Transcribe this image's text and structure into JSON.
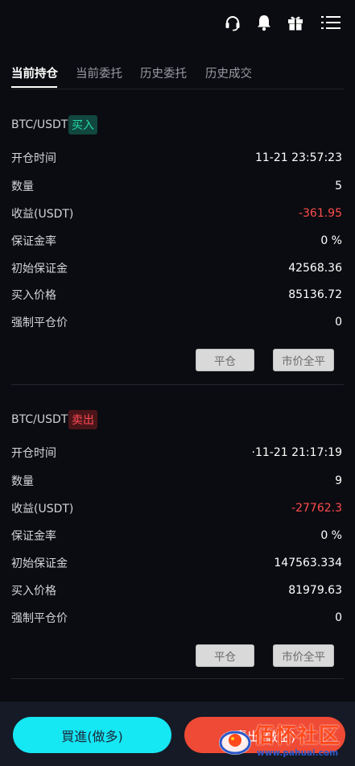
{
  "tabs": [
    "当前持仓",
    "当前委托",
    "历史委托",
    "历史成交"
  ],
  "icons": [
    "headset-icon",
    "bell-icon",
    "gift-icon",
    "menu-icon"
  ],
  "positions": [
    {
      "pair": "BTC/USDT",
      "side": "买入",
      "rows": [
        {
          "label": "开仓时间",
          "value": "11-21 23:57:23"
        },
        {
          "label": "数量",
          "value": "5"
        },
        {
          "label": "收益(USDT)",
          "value": "-361.95"
        },
        {
          "label": "保证金率",
          "value": "0 %"
        },
        {
          "label": "初始保证金",
          "value": "42568.36"
        },
        {
          "label": "买入价格",
          "value": "85136.72"
        },
        {
          "label": "强制平仓价",
          "value": "0"
        }
      ],
      "close_label": "平仓",
      "market_close_label": "市价全平"
    },
    {
      "pair": "BTC/USDT",
      "side": "卖出",
      "rows": [
        {
          "label": "开仓时间",
          "value": "·11-21 21:17:19"
        },
        {
          "label": "数量",
          "value": "9"
        },
        {
          "label": "收益(USDT)",
          "value": "-27762.3"
        },
        {
          "label": "保证金率",
          "value": "0 %"
        },
        {
          "label": "初始保证金",
          "value": "147563.334"
        },
        {
          "label": "买入价格",
          "value": "81979.63"
        },
        {
          "label": "强制平仓价",
          "value": "0"
        }
      ],
      "close_label": "平仓",
      "market_close_label": "市价全平"
    }
  ],
  "footer": {
    "buy_label": "買進(做多)",
    "sell_label": "賣出(做空)"
  },
  "watermark": {
    "text": "佰怀社区",
    "url": "www.pahuai.com"
  },
  "colors": {
    "background": "#0b0c11",
    "buy_accent": "#24d9a8",
    "sell_accent": "#ff4b55",
    "negative_value": "#ff4d4d",
    "buy_button": "#15e7f3",
    "sell_button": "#ef4a35"
  }
}
